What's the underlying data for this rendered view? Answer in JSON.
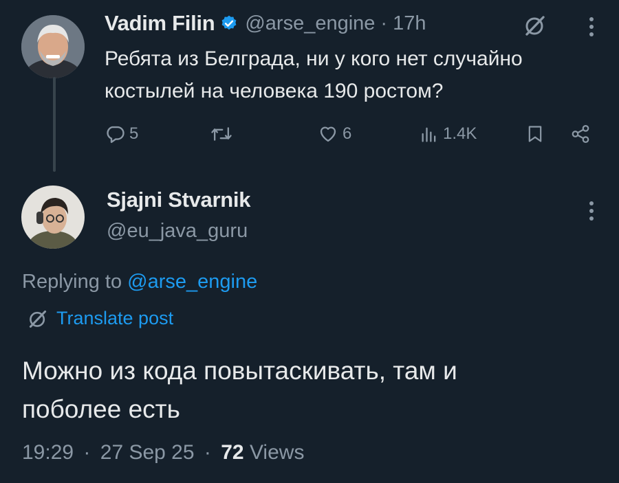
{
  "parent_tweet": {
    "author_name": "Vadim Filin",
    "handle": "@arse_engine",
    "separator": "·",
    "time": "17h",
    "text_line1": "Ребята из Белграда, ни у кого нет случайно",
    "text_line2": "костылей на человека 190 ростом?",
    "actions": {
      "replies": "5",
      "likes": "6",
      "views": "1.4K"
    }
  },
  "reply_tweet": {
    "author_name": "Sjajni Stvarnik",
    "handle": "@eu_java_guru",
    "replying_to_prefix": "Replying to ",
    "replying_to_handle": "@arse_engine",
    "translate_label": "Translate post",
    "text_line1": "Можно из кода повытаскивать, там и",
    "text_line2": "поболее есть",
    "time": "19:29",
    "date": "27 Sep 25",
    "separator": "·",
    "views_count": "72",
    "views_label": "Views"
  },
  "colors": {
    "background": "#15202b",
    "text_primary": "#e7e9ea",
    "text_muted": "#8b98a5",
    "accent": "#1d9bf0",
    "thread_line": "#38444d"
  },
  "icons": [
    "verified-badge-icon",
    "grok-icon",
    "more-icon",
    "reply-icon",
    "retweet-icon",
    "like-icon",
    "views-icon",
    "bookmark-icon",
    "share-icon",
    "translate-icon"
  ]
}
